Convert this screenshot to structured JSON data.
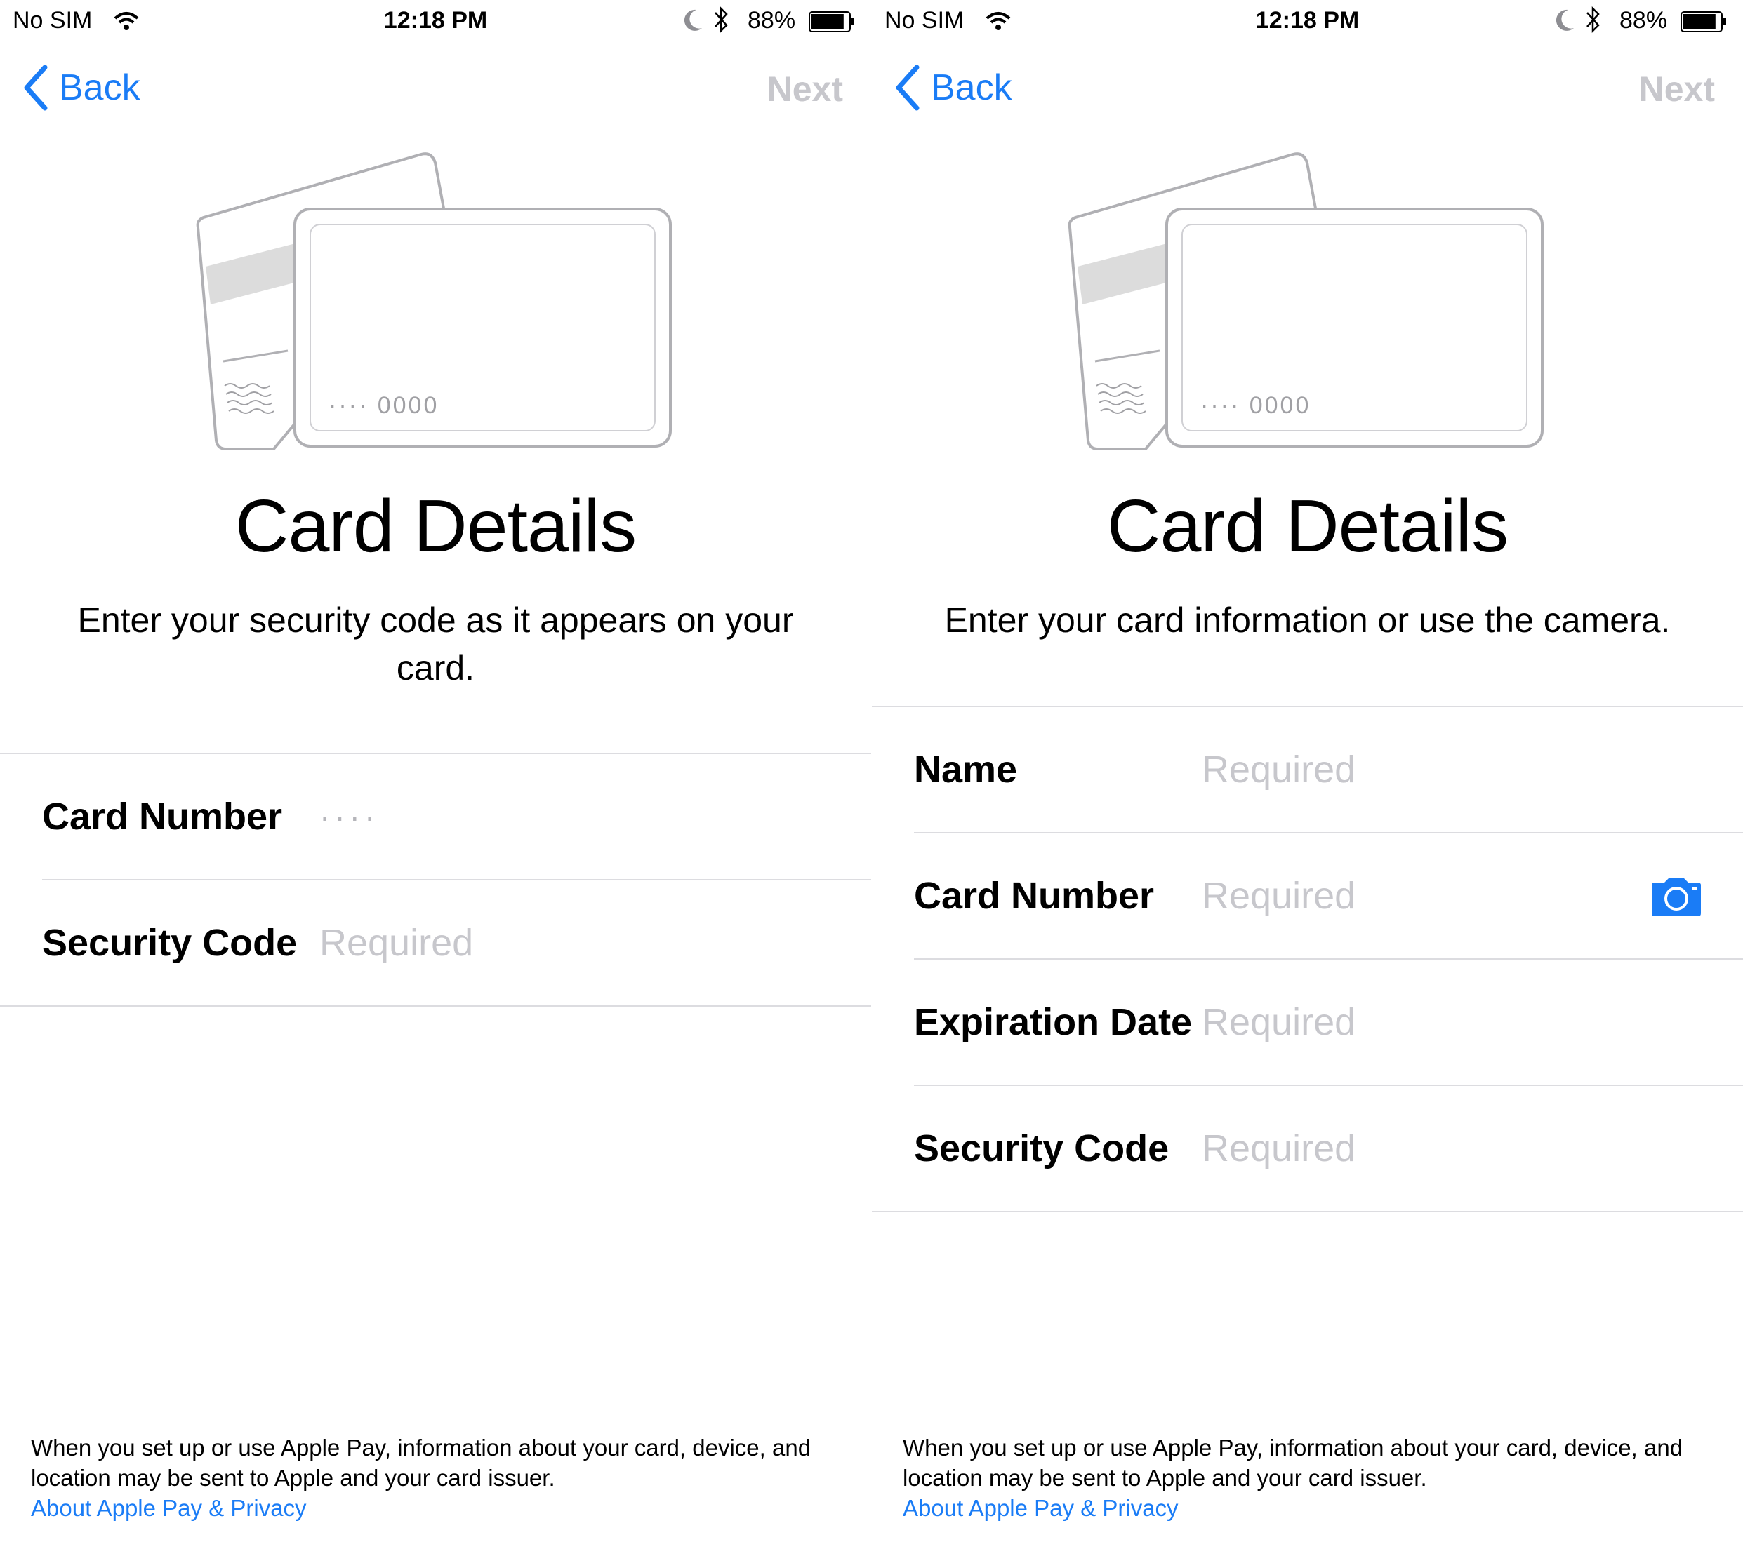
{
  "status_bar": {
    "carrier": "No SIM",
    "time": "12:18 PM",
    "battery_percent": "88%",
    "battery_level": 0.88,
    "icons": [
      "wifi-icon",
      "moon-icon",
      "bluetooth-icon",
      "battery-icon"
    ]
  },
  "nav": {
    "back_label": "Back",
    "next_label": "Next"
  },
  "colors": {
    "accent": "#1a7cf6",
    "disabled": "#c7c7cc",
    "placeholder": "#c7c7cc"
  },
  "card_illustration": {
    "masked_number": "···· 0000"
  },
  "screens": [
    {
      "title": "Card Details",
      "subtitle": "Enter your security code as it appears on your card.",
      "fields": [
        {
          "label": "Card Number",
          "value": "····"
        },
        {
          "label": "Security Code",
          "placeholder": "Required"
        }
      ]
    },
    {
      "title": "Card Details",
      "subtitle": "Enter your card information or use the camera.",
      "fields": [
        {
          "label": "Name",
          "placeholder": "Required"
        },
        {
          "label": "Card Number",
          "placeholder": "Required"
        },
        {
          "label": "Expiration Date",
          "placeholder": "Required"
        },
        {
          "label": "Security Code",
          "placeholder": "Required"
        }
      ]
    }
  ],
  "footer": {
    "text": "When you set up or use Apple Pay, information about your card, device, and location may be sent to Apple and your card issuer.",
    "link": "About Apple Pay & Privacy"
  }
}
